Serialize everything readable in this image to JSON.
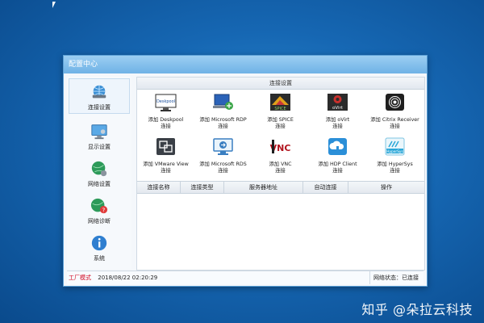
{
  "watermark": "知乎 @朵拉云科技",
  "window": {
    "title": "配置中心"
  },
  "sidebar": {
    "items": [
      {
        "label": "连接设置",
        "icon": "network-globe-icon",
        "active": true
      },
      {
        "label": "显示设置",
        "icon": "monitor-icon"
      },
      {
        "label": "网络设置",
        "icon": "network-settings-icon"
      },
      {
        "label": "网络诊断",
        "icon": "network-diagnose-icon"
      },
      {
        "label": "系统",
        "icon": "info-icon"
      }
    ]
  },
  "main": {
    "section_title": "连接设置",
    "apps": [
      {
        "line1": "添加 Deskpool",
        "line2": "连接",
        "icon": "deskpool-icon"
      },
      {
        "line1": "添加 Microsoft RDP",
        "line2": "连接",
        "icon": "rdp-icon"
      },
      {
        "line1": "添加 SPICE",
        "line2": "连接",
        "icon": "spice-icon"
      },
      {
        "line1": "添加 oVirt",
        "line2": "连接",
        "icon": "ovirt-icon"
      },
      {
        "line1": "添加 Citrix Receiver",
        "line2": "连接",
        "icon": "citrix-icon"
      },
      {
        "line1": "添加 VMware View",
        "line2": "连接",
        "icon": "vmware-icon"
      },
      {
        "line1": "添加 Microsoft RDS",
        "line2": "连接",
        "icon": "rds-icon"
      },
      {
        "line1": "添加 VNC",
        "line2": "连接",
        "icon": "vnc-icon"
      },
      {
        "line1": "添加 HDP Client",
        "line2": "连接",
        "icon": "hdp-icon"
      },
      {
        "line1": "添加 HyperSys",
        "line2": "连接",
        "icon": "hypersys-icon"
      }
    ],
    "table": {
      "columns": [
        "连接名称",
        "连接类型",
        "服务器地址",
        "自动连接",
        "操作"
      ]
    }
  },
  "status": {
    "mode": "工厂模式",
    "datetime": "2018/08/22 02:20:29",
    "network": "网络状态：已连接"
  },
  "colors": {
    "title_gradient": "#6fb2e6",
    "mode": "#d0021b",
    "desktop": "#1667b3"
  }
}
